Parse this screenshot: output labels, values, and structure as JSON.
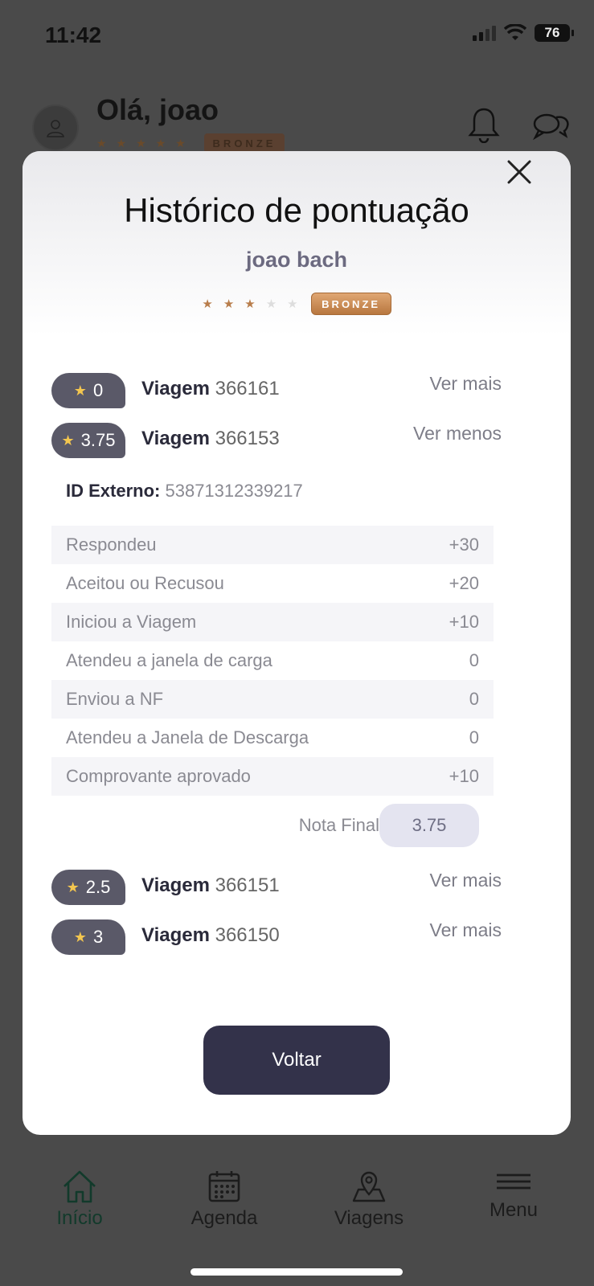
{
  "status": {
    "time": "11:42",
    "battery": "76"
  },
  "header": {
    "greeting": "Olá, joao",
    "rank_badge": "BRONZE"
  },
  "modal": {
    "title": "Histórico de pontuação",
    "user": "joao bach",
    "rank_badge": "BRONZE",
    "stars_filled": 3,
    "stars_total": 5,
    "trips": [
      {
        "score": "0",
        "label": "Viagem",
        "id": "366161",
        "link": "Ver mais"
      },
      {
        "score": "3.75",
        "label": "Viagem",
        "id": "366153",
        "link": "Ver menos"
      },
      {
        "score": "2.5",
        "label": "Viagem",
        "id": "366151",
        "link": "Ver mais"
      },
      {
        "score": "3",
        "label": "Viagem",
        "id": "366150",
        "link": "Ver mais"
      }
    ],
    "detail": {
      "ext_id_label": "ID Externo:",
      "ext_id_value": "53871312339217",
      "rows": [
        {
          "label": "Respondeu",
          "value": "+30"
        },
        {
          "label": "Aceitou ou Recusou",
          "value": "+20"
        },
        {
          "label": "Iniciou a Viagem",
          "value": "+10"
        },
        {
          "label": "Atendeu a janela de carga",
          "value": "0"
        },
        {
          "label": "Enviou a NF",
          "value": "0"
        },
        {
          "label": "Atendeu a Janela de Descarga",
          "value": "0"
        },
        {
          "label": "Comprovante aprovado",
          "value": "+10"
        }
      ],
      "final_label": "Nota Final",
      "final_value": "3.75"
    },
    "back_button": "Voltar"
  },
  "tabbar": {
    "items": [
      {
        "label": "Início",
        "icon": "home-icon"
      },
      {
        "label": "Agenda",
        "icon": "calendar-icon"
      },
      {
        "label": "Viagens",
        "icon": "map-pin-icon"
      },
      {
        "label": "Menu",
        "icon": "menu-icon"
      }
    ]
  }
}
